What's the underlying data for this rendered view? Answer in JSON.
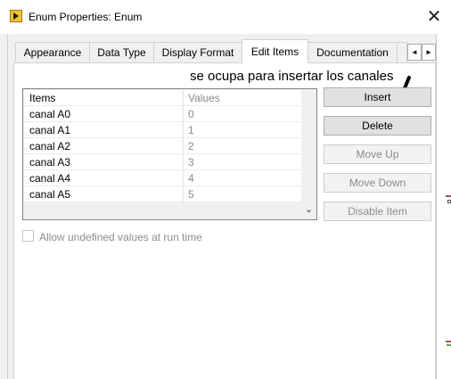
{
  "window": {
    "title": "Enum Properties: Enum",
    "close_glyph": "✕"
  },
  "tabs": [
    {
      "label": "Appearance"
    },
    {
      "label": "Data Type"
    },
    {
      "label": "Display Format"
    },
    {
      "label": "Edit Items",
      "active": true
    },
    {
      "label": "Documentation"
    }
  ],
  "tab_scroll": {
    "left_glyph": "◄",
    "right_glyph": "►"
  },
  "annotation": "se ocupa para insertar los canales",
  "items_table": {
    "columns": [
      "Items",
      "Values"
    ],
    "rows": [
      {
        "item": "canal A0",
        "value": "0"
      },
      {
        "item": "canal A1",
        "value": "1"
      },
      {
        "item": "canal A2",
        "value": "2"
      },
      {
        "item": "canal A3",
        "value": "3"
      },
      {
        "item": "canal A4",
        "value": "4"
      },
      {
        "item": "canal A5",
        "value": "5"
      }
    ],
    "scroll_down_glyph": "⌄"
  },
  "buttons": {
    "insert": "Insert",
    "delete": "Delete",
    "move_up": "Move Up",
    "move_down": "Move Down",
    "disable_item": "Disable Item"
  },
  "checkbox": {
    "label": "Allow undefined values at run time",
    "checked": false
  }
}
